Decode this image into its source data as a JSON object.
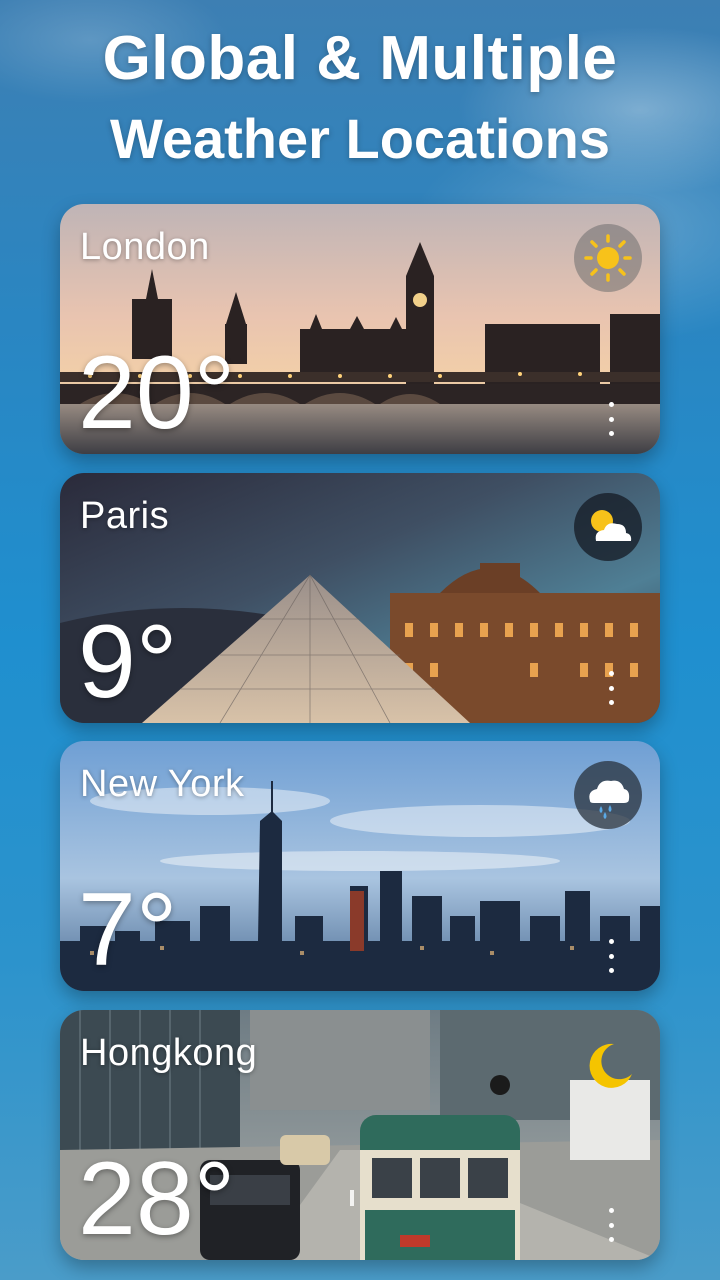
{
  "headline": {
    "line1": "Global & Multiple",
    "line2": "Weather Locations"
  },
  "locations": [
    {
      "city": "London",
      "temp": "20°",
      "condition_icon": "sun-icon"
    },
    {
      "city": "Paris",
      "temp": "9°",
      "condition_icon": "partly-cloudy-icon"
    },
    {
      "city": "New York",
      "temp": "7°",
      "condition_icon": "rain-cloud-icon"
    },
    {
      "city": "Hongkong",
      "temp": "28°",
      "condition_icon": "moon-icon"
    }
  ],
  "colors": {
    "background": "#2a86c2",
    "sun": "#f7c21a",
    "moon": "#f5c400",
    "text": "#ffffff"
  }
}
